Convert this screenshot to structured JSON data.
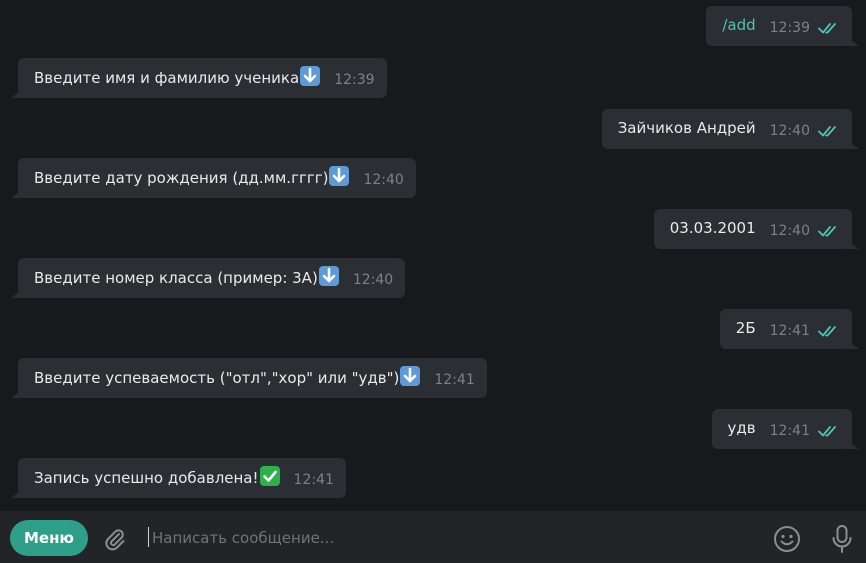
{
  "chat": {
    "messages": [
      {
        "direction": "out",
        "text": "/add",
        "time": "12:39",
        "read": true
      },
      {
        "direction": "in",
        "text": "Введите имя и фамилию ученика",
        "emoji": "down-arrow-emoji",
        "time": "12:39"
      },
      {
        "direction": "out",
        "text": "Зайчиков Андрей",
        "time": "12:40",
        "read": true
      },
      {
        "direction": "in",
        "text": "Введите дату рождения (дд.мм.гггг)",
        "emoji": "down-arrow-emoji",
        "time": "12:40"
      },
      {
        "direction": "out",
        "text": "03.03.2001",
        "time": "12:40",
        "read": true
      },
      {
        "direction": "in",
        "text": "Введите номер класса (пример: 3А)",
        "emoji": "down-arrow-emoji",
        "time": "12:40"
      },
      {
        "direction": "out",
        "text": "2Б",
        "time": "12:41",
        "read": true
      },
      {
        "direction": "in",
        "text": "Введите успеваемость (\"отл\",\"хор\" или \"удв\")",
        "emoji": "down-arrow-emoji",
        "time": "12:41"
      },
      {
        "direction": "out",
        "text": "удв",
        "time": "12:41",
        "read": true
      },
      {
        "direction": "in",
        "text": "Запись успешно добавлена!",
        "emoji": "check-mark-emoji",
        "time": "12:41"
      }
    ]
  },
  "composer": {
    "menu_label": "Меню",
    "input_placeholder": "Написать сообщение...",
    "input_value": "",
    "icons": {
      "attach": "paperclip-icon",
      "emoji": "smiley-icon",
      "voice": "microphone-icon"
    }
  },
  "colors": {
    "background": "#18191d",
    "bubble": "#2b2e33",
    "command_text": "#4fc3b5",
    "read_ticks": "#4fc3b5",
    "accent_button": "#2ea089",
    "composer_bar": "#232428"
  }
}
